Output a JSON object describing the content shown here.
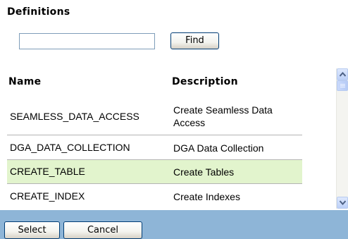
{
  "title": "Definitions",
  "search": {
    "value": "",
    "placeholder": "",
    "find_label": "Find"
  },
  "table": {
    "headers": {
      "name": "Name",
      "description": "Description"
    },
    "rows": [
      {
        "name": "SEAMLESS_DATA_ACCESS",
        "description": "Create Seamless Data Access",
        "selected": false
      },
      {
        "name": "DGA_DATA_COLLECTION",
        "description": "DGA Data Collection",
        "selected": false
      },
      {
        "name": "CREATE_TABLE",
        "description": "Create Tables",
        "selected": true
      },
      {
        "name": "CREATE_INDEX",
        "description": "Create Indexes",
        "selected": false
      }
    ]
  },
  "scrollbar": {
    "up_icon": "triangle-up-icon",
    "down_icon": "triangle-down-icon"
  },
  "footer": {
    "select_label": "Select",
    "cancel_label": "Cancel"
  },
  "colors": {
    "selected_row": "#e2f4cd",
    "footer_background": "#8eb5d7",
    "row_divider": "#b4b4b4"
  }
}
